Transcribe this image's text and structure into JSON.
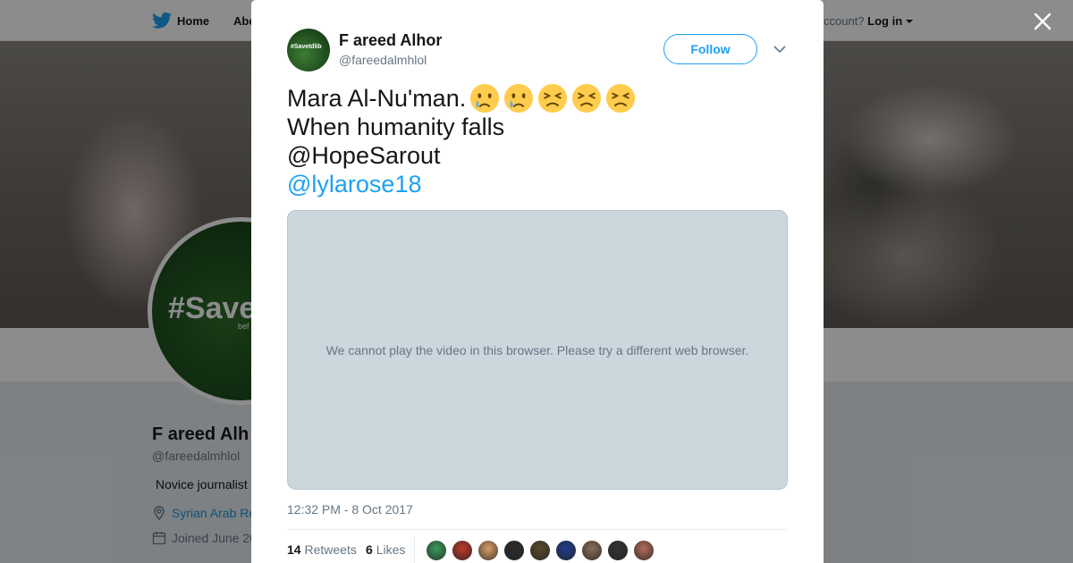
{
  "topbar": {
    "home_label": "Home",
    "about_label": "Abo",
    "have_account_text": "ccount? ",
    "login_label": "Log in"
  },
  "profile": {
    "name": "F areed Alh",
    "handle": "@fareedalmhlol",
    "bio": "Novice journalist",
    "location": "Syrian Arab Re",
    "joined": "Joined June 20",
    "avatar_text": "#Save",
    "avatar_subtext": "bef"
  },
  "tweet": {
    "author_name": "F areed Alhor",
    "author_handle": "@fareedalmhlol",
    "author_avatar_text": "#SaveIdlib",
    "follow_label": "Follow",
    "lines": [
      "Mara Al-Nu'man.",
      "When humanity falls",
      "@HopeSarout",
      "@lylarose18"
    ],
    "line1_emojis": [
      "crying-face",
      "crying-face",
      "persevering-face",
      "persevering-face",
      "persevering-face"
    ],
    "video_message": "We cannot play the video in this browser. Please try a different web browser.",
    "timestamp": "12:32 PM - 8 Oct 2017",
    "retweets_count": "14",
    "retweets_label": "Retweets",
    "likes_count": "6",
    "likes_label": "Likes",
    "liker_avatar_colors": [
      "#3a9a5c",
      "#c0392b",
      "#d9a066",
      "#2b2b2b",
      "#5a4a2a",
      "#1f3d8a",
      "#8a6e5a",
      "#333333",
      "#b56b5a"
    ]
  },
  "colors": {
    "accent": "#1da1f2",
    "mention": "#1da1f2",
    "secondary_text": "#657786",
    "video_bg": "#ccd6dd"
  }
}
